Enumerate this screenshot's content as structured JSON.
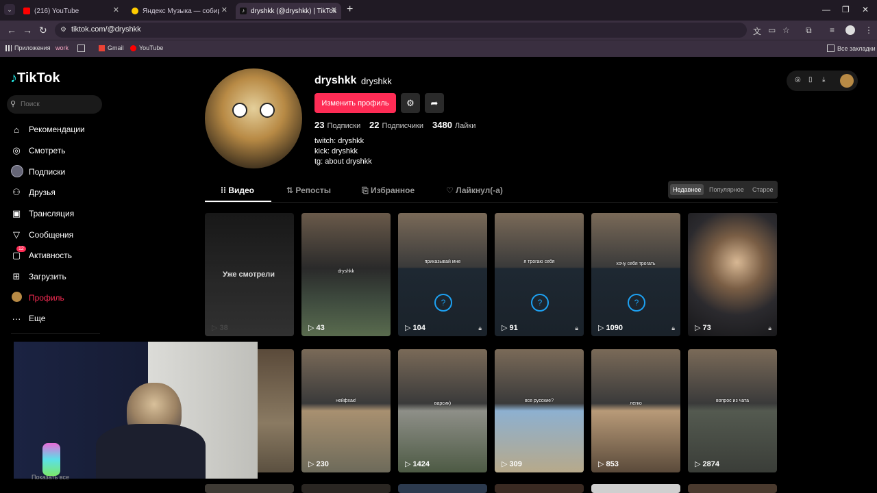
{
  "browser": {
    "tabs": [
      {
        "title": "(216) YouTube",
        "icon": "youtube-icon",
        "color": "#ff0000",
        "active": false
      },
      {
        "title": "Яндекс Музыка — собираем м",
        "icon": "yandex-music-icon",
        "color": "#ffcc00",
        "active": false
      },
      {
        "title": "dryshkk (@dryshkk) | TikTok",
        "icon": "tiktok-icon",
        "color": "#ffffff",
        "active": true
      }
    ],
    "url": "tiktok.com/@dryshkk",
    "bookmarks": [
      {
        "label": "Приложения",
        "icon": "apps-icon"
      },
      {
        "label": "work",
        "icon": "work-icon"
      },
      {
        "label": "",
        "icon": "grid-icon"
      },
      {
        "label": "Gmail",
        "icon": "gmail-icon"
      },
      {
        "label": "YouTube",
        "icon": "youtube-icon"
      }
    ],
    "all_bookmarks": "Все закладки"
  },
  "sidebar": {
    "logo": "TikTok",
    "search_placeholder": "Поиск",
    "items": [
      {
        "label": "Рекомендации",
        "icon": "home-icon"
      },
      {
        "label": "Смотреть",
        "icon": "compass-icon"
      },
      {
        "label": "Подписки",
        "icon": "avatar-icon"
      },
      {
        "label": "Друзья",
        "icon": "friends-icon"
      },
      {
        "label": "Трансляция",
        "icon": "live-icon"
      },
      {
        "label": "Сообщения",
        "icon": "send-icon"
      },
      {
        "label": "Активность",
        "icon": "inbox-icon",
        "badge": "12"
      },
      {
        "label": "Загрузить",
        "icon": "upload-icon"
      },
      {
        "label": "Профиль",
        "icon": "profile-avatar-icon",
        "active": true
      },
      {
        "label": "Еще",
        "icon": "more-icon"
      }
    ],
    "partial_bottom": "Показать все"
  },
  "profile": {
    "username": "dryshkk",
    "nickname": "dryshkk",
    "edit_label": "Изменить профиль",
    "following_count": "23",
    "following_label": "Подписки",
    "followers_count": "22",
    "followers_label": "Подписчики",
    "likes_count": "3480",
    "likes_label": "Лайки",
    "bio": [
      "twitch: dryshkk",
      "kick: dryshkk",
      "tg: about dryshkk"
    ]
  },
  "tabs": [
    {
      "label": "Видео",
      "icon": "grid-icon",
      "active": true
    },
    {
      "label": "Репосты",
      "icon": "repost-icon"
    },
    {
      "label": "Избранное",
      "icon": "bookmark-icon"
    },
    {
      "label": "Лайкнул(-а)",
      "icon": "heart-icon"
    }
  ],
  "sort": [
    {
      "label": "Недавнее",
      "active": true
    },
    {
      "label": "Популярное"
    },
    {
      "label": "Старое"
    }
  ],
  "videos": [
    {
      "views": "38",
      "watched": "Уже смотрели",
      "locked": false,
      "caption": ""
    },
    {
      "views": "43",
      "locked": false,
      "caption": "dryshkk"
    },
    {
      "views": "104",
      "locked": true,
      "caption": "приказывай мне"
    },
    {
      "views": "91",
      "locked": true,
      "caption": "я трогаю себя"
    },
    {
      "views": "1090",
      "locked": true,
      "caption": "хочу себя трогать"
    },
    {
      "views": "73",
      "locked": true,
      "caption": ""
    },
    {
      "views": "",
      "locked": false,
      "caption": ""
    },
    {
      "views": "230",
      "locked": false,
      "caption": "нейфхак!"
    },
    {
      "views": "1424",
      "locked": false,
      "caption": "варсик)"
    },
    {
      "views": "309",
      "locked": false,
      "caption": "все русские?"
    },
    {
      "views": "853",
      "locked": false,
      "caption": "легко"
    },
    {
      "views": "2874",
      "locked": false,
      "caption": "вопрос из чата"
    }
  ]
}
